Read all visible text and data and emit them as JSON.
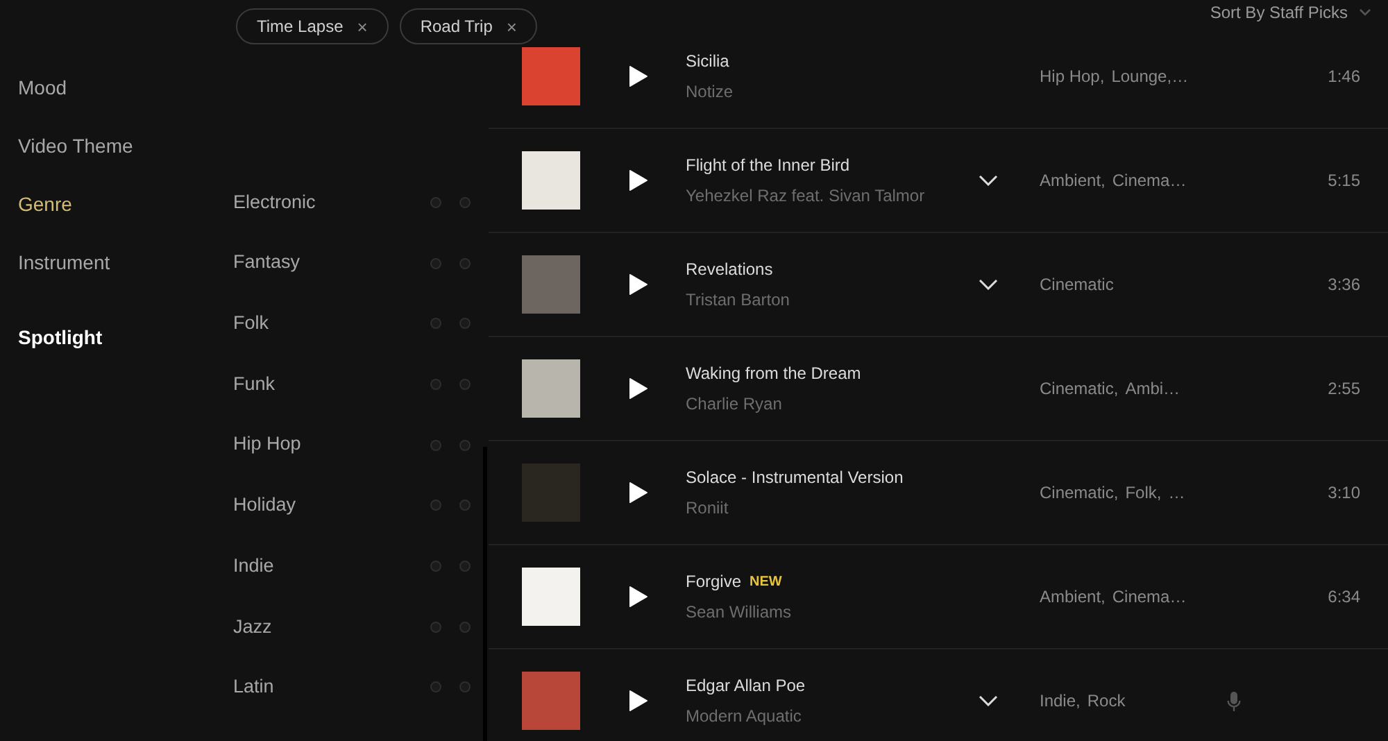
{
  "categories": [
    {
      "label": "Mood",
      "selected": false,
      "kind": "item"
    },
    {
      "label": "Video Theme",
      "selected": false,
      "kind": "item"
    },
    {
      "label": "Genre",
      "selected": true,
      "kind": "item"
    },
    {
      "label": "Instrument",
      "selected": false,
      "kind": "item"
    },
    {
      "label": "Spotlight",
      "selected": false,
      "kind": "heading"
    }
  ],
  "filters": [
    {
      "label": "Time Lapse",
      "remove": "×"
    },
    {
      "label": "Road Trip",
      "remove": "×"
    }
  ],
  "genres": [
    "Electronic",
    "Fantasy",
    "Folk",
    "Funk",
    "Hip Hop",
    "Holiday",
    "Indie",
    "Jazz",
    "Latin"
  ],
  "sort": {
    "label": "Sort By Staff Picks"
  },
  "tracks": [
    {
      "title": "Sicilia",
      "artist": "Notize",
      "expandable": false,
      "tags": [
        "Hip Hop,",
        "Lounge,…"
      ],
      "duration": "1:46",
      "color": "#d9432f",
      "vocals": false
    },
    {
      "title": "Flight of the Inner Bird",
      "artist": "Yehezkel Raz feat. Sivan Talmor",
      "expandable": true,
      "tags": [
        "Ambient,",
        "Cinema…"
      ],
      "duration": "5:15",
      "color": "#e8e6df",
      "vocals": false
    },
    {
      "title": "Revelations",
      "artist": "Tristan Barton",
      "expandable": true,
      "tags": [
        "Cinematic"
      ],
      "duration": "3:36",
      "color": "#6d6660",
      "vocals": false
    },
    {
      "title": "Waking from the Dream",
      "artist": "Charlie Ryan",
      "expandable": false,
      "tags": [
        "Cinematic,",
        "Ambi…"
      ],
      "duration": "2:55",
      "color": "#b8b5ad",
      "vocals": false
    },
    {
      "title": "Solace - Instrumental Version",
      "artist": "Roniit",
      "expandable": false,
      "tags": [
        "Cinematic,",
        "Folk,",
        "…"
      ],
      "duration": "3:10",
      "color": "#2a2620",
      "vocals": false
    },
    {
      "title": "Forgive",
      "badge": "NEW",
      "artist": "Sean Williams",
      "expandable": false,
      "tags": [
        "Ambient,",
        "Cinema…"
      ],
      "duration": "6:34",
      "color": "#f4f2ee",
      "vocals": false
    },
    {
      "title": "Edgar Allan Poe",
      "artist": "Modern Aquatic",
      "expandable": true,
      "tags": [
        "Indie,",
        "Rock"
      ],
      "color": "#b8473a",
      "vocals": true
    }
  ]
}
